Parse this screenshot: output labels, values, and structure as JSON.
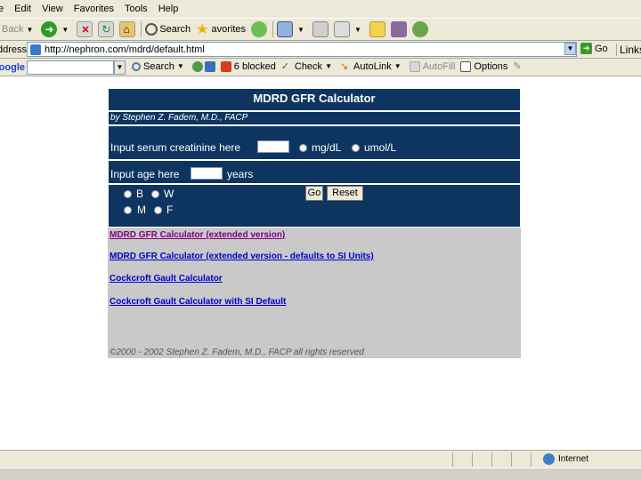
{
  "menu": [
    "e",
    "Edit",
    "View",
    "Favorites",
    "Tools",
    "Help"
  ],
  "toolbar": {
    "back_label": "Back",
    "search_label": "Search",
    "favorites_label": "avorites"
  },
  "address": {
    "label": "Address",
    "url": "http://nephron.com/mdrd/default.html",
    "go_label": "Go",
    "links_label": "Links"
  },
  "google_bar": {
    "logo": "Google",
    "search_label": "Search",
    "blocked_label": "6 blocked",
    "check_label": "Check",
    "autolink_label": "AutoLink",
    "autofill_label": "AutoFill",
    "options_label": "Options"
  },
  "calculator": {
    "title": "MDRD GFR Calculator",
    "byline": "by Stephen Z. Fadem, M.D., FACP",
    "creatinine_label": "Input serum creatinine here",
    "unit_mgdl": "mg/dL",
    "unit_umol": "umol/L",
    "age_label": "Input age here",
    "age_units": "years",
    "race_black": "B",
    "race_white": "W",
    "sex_male": "M",
    "sex_female": "F",
    "go_button": "Go",
    "reset_button": "Reset"
  },
  "links": [
    "MDRD GFR Calculator (extended version)",
    "MDRD GFR Calculator (extended version - defaults to SI Units)",
    "Cockcroft Gault Calculator",
    "Cockcroft Gault Calculator with SI Default"
  ],
  "copyright": "©2000 - 2002 Stephen Z. Fadem, M.D., FACP all rights reserved",
  "status": {
    "zone": "Internet"
  }
}
